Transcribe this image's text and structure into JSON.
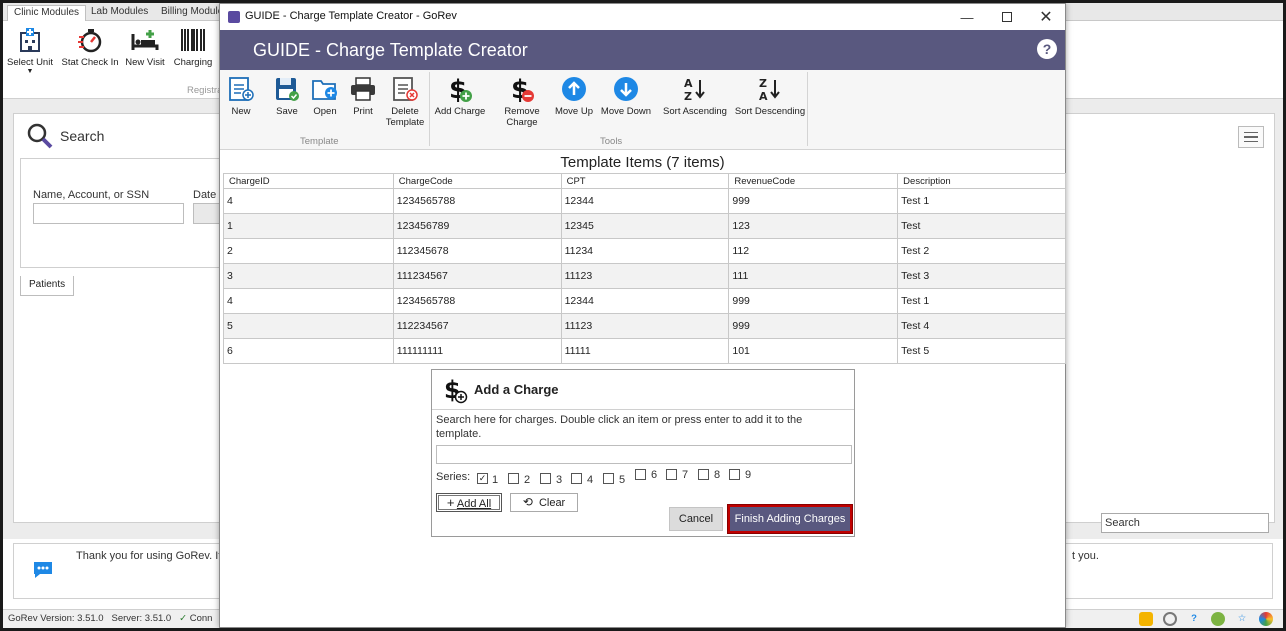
{
  "bg": {
    "tabs": [
      "Clinic Modules",
      "Lab Modules",
      "Billing Modules"
    ],
    "ribbon": [
      {
        "label": "Select Unit",
        "icon": "hospital-icon"
      },
      {
        "label": "Stat Check In",
        "icon": "stopwatch-icon"
      },
      {
        "label": "New Visit",
        "icon": "bed-plus-icon"
      },
      {
        "label": "Charging",
        "icon": "barcode-icon"
      }
    ],
    "ribbon_group": "Registra",
    "search_title": "Search",
    "name_label": "Name, Account, or SSN",
    "date_label": "Date",
    "patients_tab": "Patients",
    "right_search": "Search",
    "message_left": "Thank you for using GoRev. It",
    "message_right": "t you.",
    "status_version": "GoRev Version: 3.51.0",
    "status_server": "Server: 3.51.0",
    "status_conn": "Conn"
  },
  "dialog": {
    "window_title": "GUIDE - Charge Template Creator - GoRev",
    "header_title": "GUIDE - Charge Template Creator",
    "help": "?",
    "toolbar": {
      "template_group": "Template",
      "tools_group": "Tools",
      "new": "New",
      "save": "Save",
      "open": "Open",
      "print": "Print",
      "delete_1": "Delete",
      "delete_2": "Template",
      "add_charge": "Add Charge",
      "remove_1": "Remove",
      "remove_2": "Charge",
      "move_up": "Move Up",
      "move_down": "Move Down",
      "sort_asc": "Sort Ascending",
      "sort_desc": "Sort Descending"
    },
    "table_title": "Template Items (7 items)",
    "columns": [
      "ChargeID",
      "ChargeCode",
      "CPT",
      "RevenueCode",
      "Description"
    ],
    "rows": [
      [
        "4",
        "1234565788",
        "12344",
        "999",
        "Test 1"
      ],
      [
        "1",
        "123456789",
        "12345",
        "123",
        "Test"
      ],
      [
        "2",
        "112345678",
        "11234",
        "112",
        "Test 2"
      ],
      [
        "3",
        "111234567",
        "11123",
        "111",
        "Test 3"
      ],
      [
        "4",
        "1234565788",
        "12344",
        "999",
        "Test 1"
      ],
      [
        "5",
        "112234567",
        "11123",
        "999",
        "Test 4"
      ],
      [
        "6",
        "111111111",
        "11111",
        "101",
        "Test 5"
      ]
    ]
  },
  "add_charge": {
    "title": "Add a Charge",
    "description": "Search here for charges. Double click an item or press enter to add it to the template.",
    "search_value": "",
    "series_label": "Series:",
    "series": [
      {
        "label": "1",
        "checked": true
      },
      {
        "label": "2",
        "checked": false
      },
      {
        "label": "3",
        "checked": false
      },
      {
        "label": "4",
        "checked": false
      },
      {
        "label": "5",
        "checked": false
      },
      {
        "label": "6",
        "checked": false
      },
      {
        "label": "7",
        "checked": false
      },
      {
        "label": "8",
        "checked": false
      },
      {
        "label": "9",
        "checked": false
      }
    ],
    "add_all": "Add All",
    "clear": "Clear",
    "cancel": "Cancel",
    "finish": "Finish Adding Charges"
  },
  "colors": {
    "header": "#59587f",
    "highlight": "#c00000",
    "accent_blue": "#1e88e5"
  }
}
